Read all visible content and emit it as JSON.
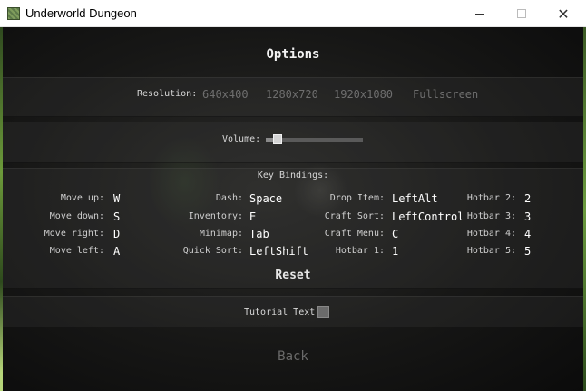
{
  "window": {
    "title": "Underworld Dungeon",
    "minimize_icon": "minimize-icon",
    "maximize_icon": "maximize-icon",
    "close_icon": "close-icon",
    "close_glyph": "✕"
  },
  "menu": {
    "title": "Options",
    "resolution": {
      "label": "Resolution:",
      "options": [
        "640x400",
        "1280x720",
        "1920x1080",
        "Fullscreen"
      ]
    },
    "volume": {
      "label": "Volume:",
      "level": 0.08
    },
    "key_bindings": {
      "title": "Key Bindings:",
      "columns": [
        [
          {
            "label": "Move up:",
            "key": "W"
          },
          {
            "label": "Move down:",
            "key": "S"
          },
          {
            "label": "Move right:",
            "key": "D"
          },
          {
            "label": "Move left:",
            "key": "A"
          }
        ],
        [
          {
            "label": "Dash:",
            "key": "Space"
          },
          {
            "label": "Inventory:",
            "key": "E"
          },
          {
            "label": "Minimap:",
            "key": "Tab"
          },
          {
            "label": "Quick Sort:",
            "key": "LeftShift"
          }
        ],
        [
          {
            "label": "Drop Item:",
            "key": "LeftAlt"
          },
          {
            "label": "Craft Sort:",
            "key": "LeftControl"
          },
          {
            "label": "Craft Menu:",
            "key": "C"
          },
          {
            "label": "Hotbar 1:",
            "key": "1"
          }
        ],
        [
          {
            "label": "Hotbar 2:",
            "key": "2"
          },
          {
            "label": "Hotbar 3:",
            "key": "3"
          },
          {
            "label": "Hotbar 4:",
            "key": "4"
          },
          {
            "label": "Hotbar 5:",
            "key": "5"
          }
        ]
      ]
    },
    "reset_label": "Reset",
    "tutorial_text": {
      "label": "Tutorial Text:",
      "checked": false
    },
    "back_label": "Back"
  }
}
